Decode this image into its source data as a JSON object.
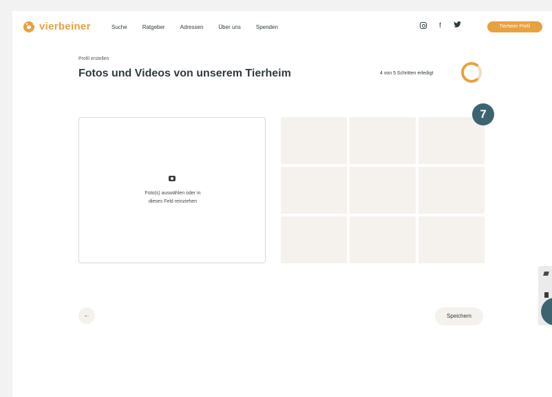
{
  "brand": {
    "name": "vierbeiner",
    "accent": "#e8a13f",
    "dark": "#3d6371"
  },
  "nav": {
    "items": [
      "Suche",
      "Ratgeber",
      "Adressen",
      "Über uns",
      "Spenden"
    ]
  },
  "social": {
    "icons": [
      "instagram-icon",
      "facebook-icon",
      "twitter-icon"
    ],
    "facebook_glyph": "f"
  },
  "header": {
    "profile_button": "Tierheim Profil"
  },
  "page": {
    "breadcrumb": "Profil erstellen",
    "title": "Fotos und Videos von unserem Tierheim",
    "progress_text": "4 von 5 Schritten erledigt",
    "progress": {
      "done": 4,
      "total": 5
    },
    "step_badge": "7"
  },
  "upload": {
    "text_line1": "Foto(s) auswählen oder in",
    "text_line2": "dieses Feld reinziehen"
  },
  "footer": {
    "back_glyph": "←",
    "save_label": "Speichern"
  }
}
